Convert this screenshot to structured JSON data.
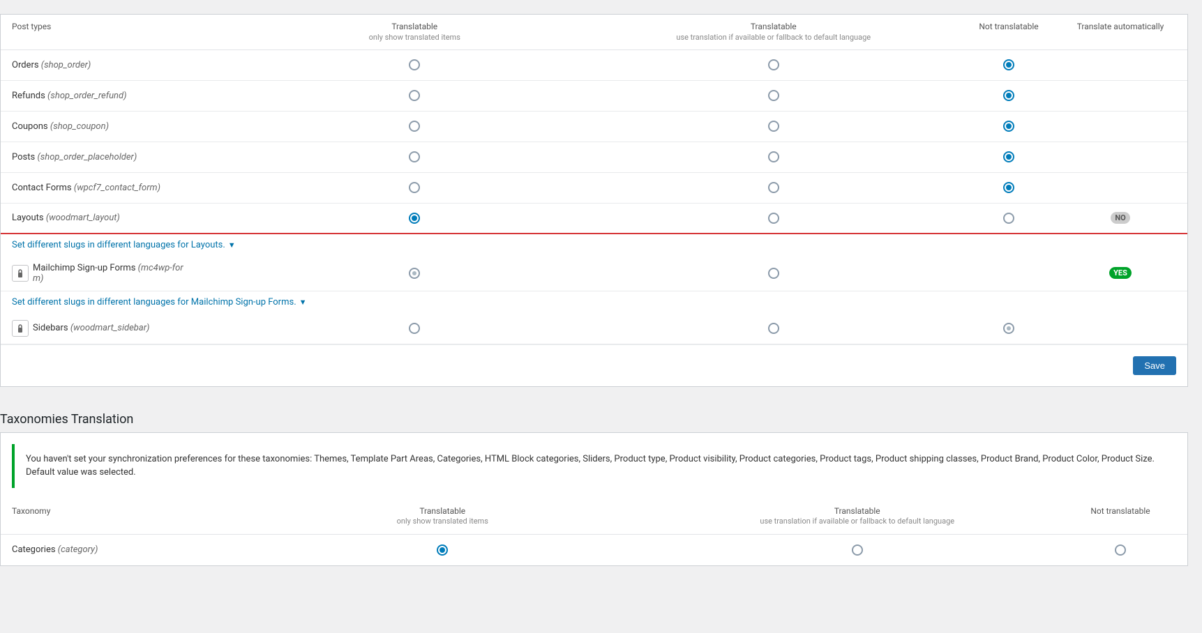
{
  "columns": {
    "post_types": "Post types",
    "translatable_show": "Translatable",
    "translatable_show_sub": "only show translated items",
    "translatable_fallback": "Translatable",
    "translatable_fallback_sub": "use translation if available or fallback to default language",
    "not_translatable": "Not translatable",
    "translate_automatically": "Translate automatically"
  },
  "rows": [
    {
      "id": "orders",
      "label": "Orders",
      "slug": "shop_order",
      "translatable_show": false,
      "translatable_fallback": false,
      "not_translatable": true,
      "auto": null,
      "locked": false,
      "highlight": false
    },
    {
      "id": "refunds",
      "label": "Refunds",
      "slug": "shop_order_refund",
      "translatable_show": false,
      "translatable_fallback": false,
      "not_translatable": true,
      "auto": null,
      "locked": false,
      "highlight": false
    },
    {
      "id": "coupons",
      "label": "Coupons",
      "slug": "shop_coupon",
      "translatable_show": false,
      "translatable_fallback": false,
      "not_translatable": true,
      "auto": null,
      "locked": false,
      "highlight": false
    },
    {
      "id": "posts",
      "label": "Posts",
      "slug": "shop_order_placeholder",
      "translatable_show": false,
      "translatable_fallback": false,
      "not_translatable": true,
      "auto": null,
      "locked": false,
      "highlight": false
    },
    {
      "id": "contact_forms",
      "label": "Contact Forms",
      "slug": "wpcf7_contact_form",
      "translatable_show": false,
      "translatable_fallback": false,
      "not_translatable": true,
      "auto": null,
      "locked": false,
      "highlight": false
    },
    {
      "id": "layouts",
      "label": "Layouts",
      "slug": "woodmart_layout",
      "translatable_show": true,
      "translatable_fallback": false,
      "not_translatable": false,
      "auto": "NO",
      "locked": false,
      "highlight": true,
      "slug_link": "Set different slugs in different languages for Layouts."
    },
    {
      "id": "mailchimp",
      "label": "Mailchimp Sign-up Forms",
      "slug": "mc4wp-form",
      "slug_display": "mc4wp-for\nm)",
      "translatable_show": "dot",
      "translatable_fallback": false,
      "not_translatable": false,
      "auto": "YES",
      "locked": true,
      "highlight": false,
      "slug_link": "Set different slugs in different languages for Mailchimp Sign-up Forms."
    },
    {
      "id": "sidebars",
      "label": "Sidebars",
      "slug": "woodmart_sidebar",
      "translatable_show": false,
      "translatable_fallback": false,
      "not_translatable": "dot",
      "auto": null,
      "locked": true,
      "highlight": false
    }
  ],
  "save_label": "Save",
  "taxonomies_section": {
    "title": "Taxonomies Translation",
    "notice": "You haven't set your synchronization preferences for these taxonomies: Themes, Template Part Areas, Categories, HTML Block categories, Sliders, Product type, Product visibility, Product categories, Product tags, Product shipping classes, Product Brand, Product Color, Product Size. Default value was selected.",
    "columns": {
      "taxonomy": "Taxonomy",
      "translatable_show": "Translatable",
      "translatable_show_sub": "only show translated items",
      "translatable_fallback": "Translatable",
      "translatable_fallback_sub": "use translation if available or fallback to default language",
      "not_translatable": "Not translatable"
    },
    "rows": [
      {
        "id": "categories",
        "label": "Categories",
        "slug": "category",
        "translatable_show": true,
        "translatable_fallback": false,
        "not_translatable": false
      }
    ]
  }
}
